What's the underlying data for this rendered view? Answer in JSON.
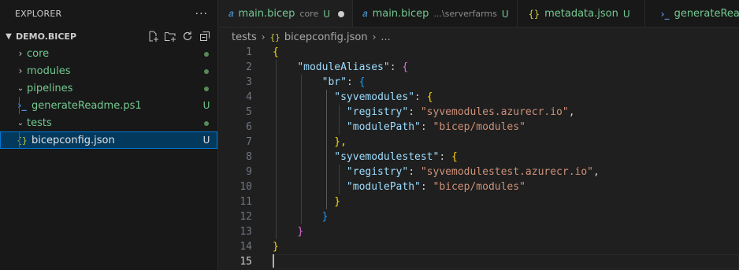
{
  "explorer": {
    "title": "EXPLORER",
    "more_glyph": "···",
    "section_title": "DEMO.BICEP",
    "items": [
      {
        "label": "core",
        "type": "folder",
        "status": "dot"
      },
      {
        "label": "modules",
        "type": "folder",
        "status": "dot"
      },
      {
        "label": "pipelines",
        "type": "folder",
        "status": "dot"
      },
      {
        "label": "generateReadme.ps1",
        "type": "file",
        "status": "U"
      },
      {
        "label": "tests",
        "type": "folder",
        "status": "dot"
      },
      {
        "label": "bicepconfig.json",
        "type": "file",
        "status": "U"
      }
    ],
    "colors": {
      "untracked": "#73c991",
      "selection": "#04395e",
      "focus_border": "#0078d4"
    }
  },
  "tabs": [
    {
      "label": "main.bicep",
      "description": "core",
      "modified": "U",
      "dirty": true,
      "icon": "bicep-icon"
    },
    {
      "label": "main.bicep",
      "description": "...\\serverfarms",
      "modified": "U",
      "dirty": false,
      "icon": "bicep-icon"
    },
    {
      "label": "metadata.json",
      "description": "",
      "modified": "U",
      "dirty": false,
      "icon": "json-icon"
    },
    {
      "label": "generateReadme",
      "description": "",
      "modified": "",
      "dirty": false,
      "icon": "powershell-icon"
    }
  ],
  "breadcrumb": {
    "folder": "tests",
    "file": "bicepconfig.json",
    "more": "..."
  },
  "editor": {
    "line_numbers": [
      "1",
      "2",
      "3",
      "4",
      "5",
      "6",
      "7",
      "8",
      "9",
      "10",
      "11",
      "12",
      "13",
      "14",
      "15"
    ],
    "active_line": 15,
    "tokens": {
      "l1_open": "{",
      "k_moduleAliases": "\"moduleAliases\"",
      "colon": ": ",
      "colon_nospace": ":",
      "l2_open": "{",
      "k_br": "\"br\"",
      "l3_open": "{",
      "k_syvemodules": "\"syvemodules\"",
      "k_registry": "\"registry\"",
      "v_registry1": "\"syvemodules.azurecr.io\"",
      "comma": ",",
      "k_modulePath": "\"modulePath\"",
      "v_modulePath1": "\"bicep/modules\"",
      "close_comma": "},",
      "k_syvemodulestest": "\"syvemodulestest\"",
      "v_registry2": "\"syvemodulestest.azurecr.io\"",
      "v_modulePath2": "\"bicep/modules\"",
      "close": "}"
    }
  }
}
